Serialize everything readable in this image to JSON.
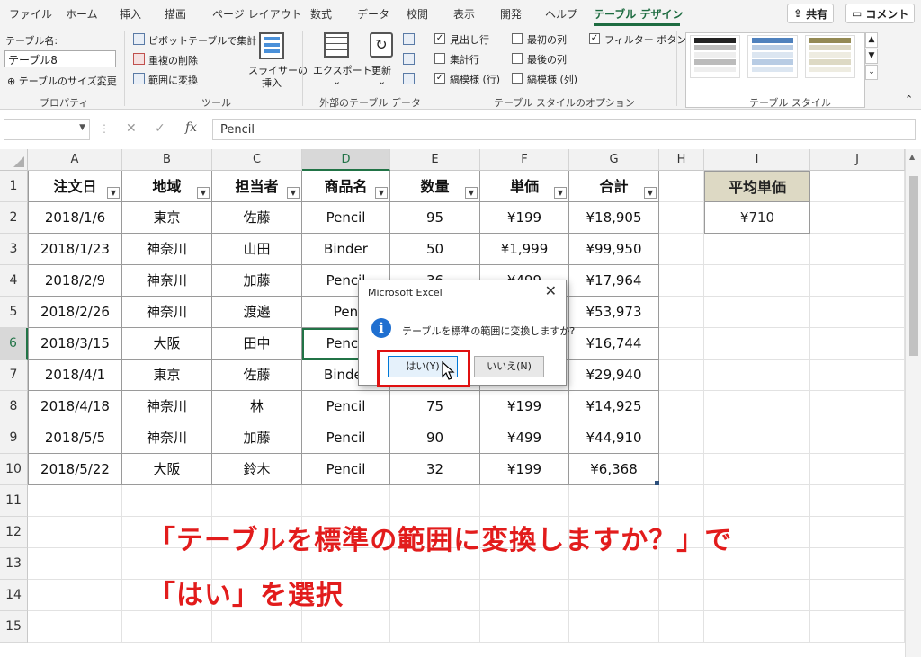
{
  "ribbon_tabs": [
    "ファイル",
    "ホーム",
    "挿入",
    "描画",
    "ページ レイアウト",
    "数式",
    "データ",
    "校閲",
    "表示",
    "開発",
    "ヘルプ",
    "テーブル デザイン"
  ],
  "active_tab": "テーブル デザイン",
  "share_label": "共有",
  "comment_label": "コメント",
  "ribbon": {
    "properties": {
      "name_label": "テーブル名:",
      "name_value": "テーブル8",
      "resize_label": "テーブルのサイズ変更",
      "group_label": "プロパティ"
    },
    "tools": {
      "pivot": "ピボットテーブルで集計",
      "remove_dup": "重複の削除",
      "convert_range": "範囲に変換",
      "slicer_1": "スライサーの",
      "slicer_2": "挿入",
      "group_label": "ツール"
    },
    "external": {
      "export": "エクスポート",
      "refresh": "更新",
      "group_label": "外部のテーブル データ"
    },
    "style_options": {
      "header_row": "見出し行",
      "total_row": "集計行",
      "banded_rows": "縞模様 (行)",
      "first_col": "最初の列",
      "last_col": "最後の列",
      "banded_cols": "縞模様 (列)",
      "filter_btn": "フィルター ボタン",
      "header_row_checked": true,
      "total_row_checked": false,
      "banded_rows_checked": true,
      "first_col_checked": false,
      "last_col_checked": false,
      "banded_cols_checked": false,
      "filter_btn_checked": true,
      "group_label": "テーブル スタイルのオプション"
    },
    "table_styles": {
      "group_label": "テーブル スタイル"
    }
  },
  "formula_bar": {
    "fx": "fx",
    "value": "Pencil"
  },
  "columns": [
    "A",
    "B",
    "C",
    "D",
    "E",
    "F",
    "G",
    "H",
    "I",
    "J"
  ],
  "rows": [
    "1",
    "2",
    "3",
    "4",
    "5",
    "6",
    "7",
    "8",
    "9",
    "10",
    "11",
    "12",
    "13",
    "14",
    "15"
  ],
  "table": {
    "headers": [
      "注文日",
      "地域",
      "担当者",
      "商品名",
      "数量",
      "単価",
      "合計"
    ],
    "data": [
      [
        "2018/1/6",
        "東京",
        "佐藤",
        "Pencil",
        "95",
        "¥199",
        "¥18,905"
      ],
      [
        "2018/1/23",
        "神奈川",
        "山田",
        "Binder",
        "50",
        "¥1,999",
        "¥99,950"
      ],
      [
        "2018/2/9",
        "神奈川",
        "加藤",
        "Pencil",
        "36",
        "¥499",
        "¥17,964"
      ],
      [
        "2018/2/26",
        "神奈川",
        "渡邉",
        "Pen",
        "",
        "",
        "¥53,973"
      ],
      [
        "2018/3/15",
        "大阪",
        "田中",
        "Pencil",
        "",
        "",
        "¥16,744"
      ],
      [
        "2018/4/1",
        "東京",
        "佐藤",
        "Binder",
        "",
        "",
        "¥29,940"
      ],
      [
        "2018/4/18",
        "神奈川",
        "林",
        "Pencil",
        "75",
        "¥199",
        "¥14,925"
      ],
      [
        "2018/5/5",
        "神奈川",
        "加藤",
        "Pencil",
        "90",
        "¥499",
        "¥44,910"
      ],
      [
        "2018/5/22",
        "大阪",
        "鈴木",
        "Pencil",
        "32",
        "¥199",
        "¥6,368"
      ]
    ]
  },
  "avg_table": {
    "header": "平均単価",
    "value": "¥710"
  },
  "dialog": {
    "title": "Microsoft Excel",
    "message": "テーブルを標準の範囲に変換しますか?",
    "yes": "はい(Y)",
    "no": "いいえ(N)"
  },
  "annotation": {
    "line1": "「テーブルを標準の範囲に変換しますか？」で",
    "line2": "「はい」を選択"
  },
  "colors": {
    "accent": "#217346",
    "annotation": "#e21c1c",
    "avg_header_bg": "#ddd9c4"
  }
}
